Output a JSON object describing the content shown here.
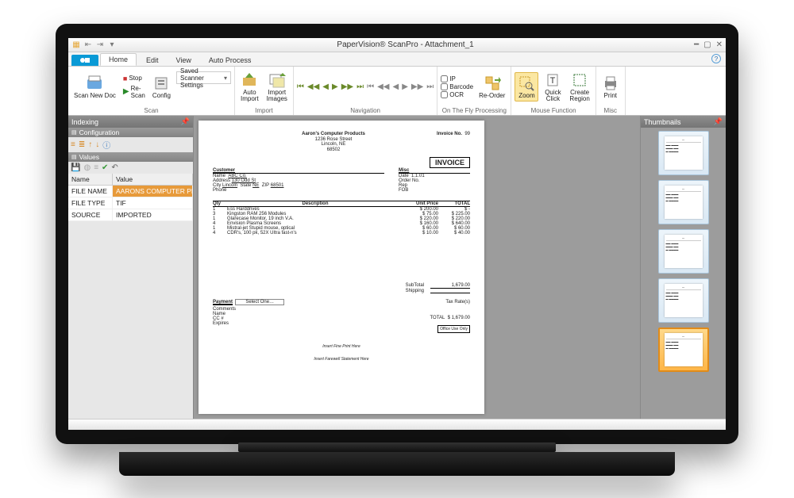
{
  "app_title": "PaperVision® ScanPro - Attachment_1",
  "tabs": {
    "file": "",
    "home": "Home",
    "edit": "Edit",
    "view": "View",
    "auto_process": "Auto Process"
  },
  "ribbon": {
    "scan_group": "Scan",
    "scan_new_doc": "Scan New Doc",
    "stop": "Stop",
    "rescan": "Re-Scan",
    "config": "Config",
    "saved_settings": "Saved Scanner Settings",
    "import_group": "Import",
    "auto_import": "Auto\nImport",
    "import_images": "Import\nImages",
    "nav_group": "Navigation",
    "otf_group": "On The Fly Processing",
    "otf_ip": "IP",
    "otf_barcode": "Barcode",
    "otf_ocr": "OCR",
    "reorder": "Re-Order",
    "mouse_group": "Mouse Function",
    "zoom": "Zoom",
    "quick_click": "Quick\nClick",
    "create_region": "Create\nRegion",
    "misc_group": "Misc",
    "print": "Print"
  },
  "left": {
    "indexing": "Indexing",
    "configuration": "Configuration",
    "values": "Values",
    "col_name": "Name",
    "col_value": "Value",
    "rows": [
      {
        "name": "FILE NAME",
        "value": "AARONS COMPUTER PR",
        "highlight": true
      },
      {
        "name": "FILE TYPE",
        "value": "TIF",
        "highlight": false
      },
      {
        "name": "SOURCE",
        "value": "IMPORTED",
        "highlight": false
      }
    ]
  },
  "thumbs": {
    "title": "Thumbnails",
    "count": 5,
    "selected_index": 4
  },
  "invoice": {
    "company_name": "Aaron's Computer Products",
    "company_addr1": "1236 Rose Street",
    "company_addr2": "Lincoln, NE",
    "company_zip": "68502",
    "invoice_no_label": "Invoice No.",
    "invoice_no": "99",
    "title": "INVOICE",
    "customer_h": "Customer",
    "cust_name_l": "Name",
    "cust_name": "ABC Co.",
    "cust_addr_l": "Address",
    "cust_addr": "130 Odd St",
    "cust_city_l": "City",
    "cust_city": "Lincoln",
    "cust_state_l": "State",
    "cust_state": "NE",
    "cust_zip_l": "ZIP",
    "cust_zip": "68501",
    "cust_phone_l": "Phone",
    "misc_h": "Misc",
    "date_l": "Date",
    "date": "1.1.01",
    "order_l": "Order No.",
    "rep_l": "Rep",
    "fob_l": "FOB",
    "qty_h": "Qty",
    "desc_h": "Description",
    "price_h": "Unit Price",
    "total_h": "TOTAL",
    "lines": [
      {
        "qty": "1",
        "desc": "Ess Harddrives",
        "price": "$ 200.00",
        "total": "$   -"
      },
      {
        "qty": "3",
        "desc": "Kingston RAM 256 Modules",
        "price": "$  75.00",
        "total": "$ 225.00"
      },
      {
        "qty": "1",
        "desc": "Glarecase Monitor, 19 inch V.A.",
        "price": "$ 220.00",
        "total": "$ 220.00"
      },
      {
        "qty": "4",
        "desc": "Envision Plasma Screens",
        "price": "$ 160.00",
        "total": "$ 640.00"
      },
      {
        "qty": "1",
        "desc": "Mistral-jet Stupid mouse, optical",
        "price": "$  60.00",
        "total": "$  60.00"
      },
      {
        "qty": "4",
        "desc": "CDR's, 100 pk, 52X Ultra fast-n's",
        "price": "$  10.00",
        "total": "$  40.00"
      }
    ],
    "subtotal_l": "SubTotal",
    "subtotal": "1,679.00",
    "shipping_l": "Shipping",
    "payment_l": "Payment",
    "payment_v": "Select One…",
    "tax_l": "Tax Rate(s)",
    "comments_l": "Comments",
    "name2_l": "Name",
    "cc_l": "CC #",
    "expires_l": "Expires",
    "total_l": "TOTAL",
    "total": "$   1,679.00",
    "office_l": "Office Use Only",
    "fineprint": "Insert Fine Print Here",
    "farewell": "Insert Farewell Statement Here"
  }
}
